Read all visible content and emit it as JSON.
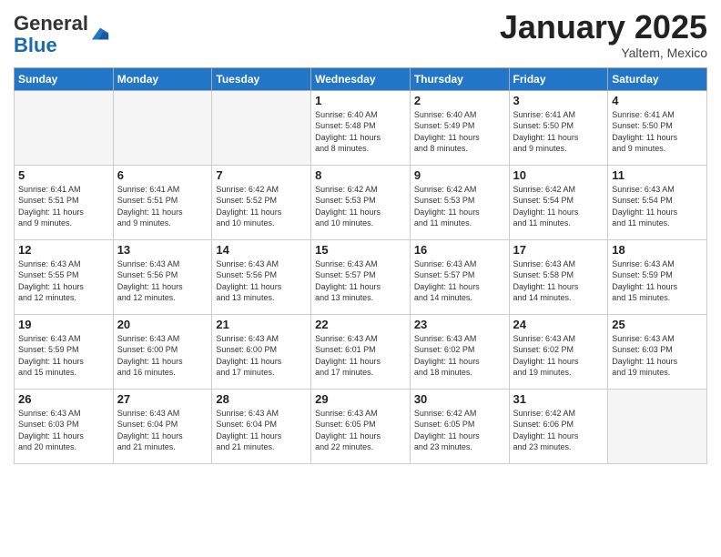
{
  "header": {
    "logo_general": "General",
    "logo_blue": "Blue",
    "month_title": "January 2025",
    "location": "Yaltem, Mexico"
  },
  "days_of_week": [
    "Sunday",
    "Monday",
    "Tuesday",
    "Wednesday",
    "Thursday",
    "Friday",
    "Saturday"
  ],
  "weeks": [
    [
      {
        "day": "",
        "info": ""
      },
      {
        "day": "",
        "info": ""
      },
      {
        "day": "",
        "info": ""
      },
      {
        "day": "1",
        "info": "Sunrise: 6:40 AM\nSunset: 5:48 PM\nDaylight: 11 hours\nand 8 minutes."
      },
      {
        "day": "2",
        "info": "Sunrise: 6:40 AM\nSunset: 5:49 PM\nDaylight: 11 hours\nand 8 minutes."
      },
      {
        "day": "3",
        "info": "Sunrise: 6:41 AM\nSunset: 5:50 PM\nDaylight: 11 hours\nand 9 minutes."
      },
      {
        "day": "4",
        "info": "Sunrise: 6:41 AM\nSunset: 5:50 PM\nDaylight: 11 hours\nand 9 minutes."
      }
    ],
    [
      {
        "day": "5",
        "info": "Sunrise: 6:41 AM\nSunset: 5:51 PM\nDaylight: 11 hours\nand 9 minutes."
      },
      {
        "day": "6",
        "info": "Sunrise: 6:41 AM\nSunset: 5:51 PM\nDaylight: 11 hours\nand 9 minutes."
      },
      {
        "day": "7",
        "info": "Sunrise: 6:42 AM\nSunset: 5:52 PM\nDaylight: 11 hours\nand 10 minutes."
      },
      {
        "day": "8",
        "info": "Sunrise: 6:42 AM\nSunset: 5:53 PM\nDaylight: 11 hours\nand 10 minutes."
      },
      {
        "day": "9",
        "info": "Sunrise: 6:42 AM\nSunset: 5:53 PM\nDaylight: 11 hours\nand 11 minutes."
      },
      {
        "day": "10",
        "info": "Sunrise: 6:42 AM\nSunset: 5:54 PM\nDaylight: 11 hours\nand 11 minutes."
      },
      {
        "day": "11",
        "info": "Sunrise: 6:43 AM\nSunset: 5:54 PM\nDaylight: 11 hours\nand 11 minutes."
      }
    ],
    [
      {
        "day": "12",
        "info": "Sunrise: 6:43 AM\nSunset: 5:55 PM\nDaylight: 11 hours\nand 12 minutes."
      },
      {
        "day": "13",
        "info": "Sunrise: 6:43 AM\nSunset: 5:56 PM\nDaylight: 11 hours\nand 12 minutes."
      },
      {
        "day": "14",
        "info": "Sunrise: 6:43 AM\nSunset: 5:56 PM\nDaylight: 11 hours\nand 13 minutes."
      },
      {
        "day": "15",
        "info": "Sunrise: 6:43 AM\nSunset: 5:57 PM\nDaylight: 11 hours\nand 13 minutes."
      },
      {
        "day": "16",
        "info": "Sunrise: 6:43 AM\nSunset: 5:57 PM\nDaylight: 11 hours\nand 14 minutes."
      },
      {
        "day": "17",
        "info": "Sunrise: 6:43 AM\nSunset: 5:58 PM\nDaylight: 11 hours\nand 14 minutes."
      },
      {
        "day": "18",
        "info": "Sunrise: 6:43 AM\nSunset: 5:59 PM\nDaylight: 11 hours\nand 15 minutes."
      }
    ],
    [
      {
        "day": "19",
        "info": "Sunrise: 6:43 AM\nSunset: 5:59 PM\nDaylight: 11 hours\nand 15 minutes."
      },
      {
        "day": "20",
        "info": "Sunrise: 6:43 AM\nSunset: 6:00 PM\nDaylight: 11 hours\nand 16 minutes."
      },
      {
        "day": "21",
        "info": "Sunrise: 6:43 AM\nSunset: 6:00 PM\nDaylight: 11 hours\nand 17 minutes."
      },
      {
        "day": "22",
        "info": "Sunrise: 6:43 AM\nSunset: 6:01 PM\nDaylight: 11 hours\nand 17 minutes."
      },
      {
        "day": "23",
        "info": "Sunrise: 6:43 AM\nSunset: 6:02 PM\nDaylight: 11 hours\nand 18 minutes."
      },
      {
        "day": "24",
        "info": "Sunrise: 6:43 AM\nSunset: 6:02 PM\nDaylight: 11 hours\nand 19 minutes."
      },
      {
        "day": "25",
        "info": "Sunrise: 6:43 AM\nSunset: 6:03 PM\nDaylight: 11 hours\nand 19 minutes."
      }
    ],
    [
      {
        "day": "26",
        "info": "Sunrise: 6:43 AM\nSunset: 6:03 PM\nDaylight: 11 hours\nand 20 minutes."
      },
      {
        "day": "27",
        "info": "Sunrise: 6:43 AM\nSunset: 6:04 PM\nDaylight: 11 hours\nand 21 minutes."
      },
      {
        "day": "28",
        "info": "Sunrise: 6:43 AM\nSunset: 6:04 PM\nDaylight: 11 hours\nand 21 minutes."
      },
      {
        "day": "29",
        "info": "Sunrise: 6:43 AM\nSunset: 6:05 PM\nDaylight: 11 hours\nand 22 minutes."
      },
      {
        "day": "30",
        "info": "Sunrise: 6:42 AM\nSunset: 6:05 PM\nDaylight: 11 hours\nand 23 minutes."
      },
      {
        "day": "31",
        "info": "Sunrise: 6:42 AM\nSunset: 6:06 PM\nDaylight: 11 hours\nand 23 minutes."
      },
      {
        "day": "",
        "info": ""
      }
    ]
  ]
}
